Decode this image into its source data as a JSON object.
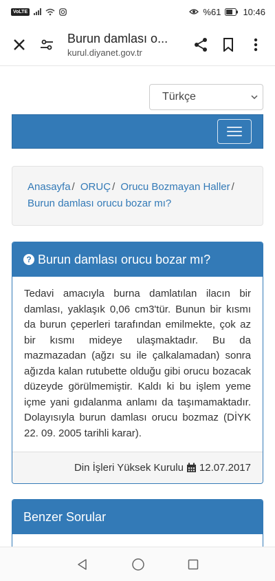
{
  "status": {
    "volte": "VoLTE",
    "battery": "%61",
    "time": "10:46"
  },
  "browser": {
    "title": "Burun damlası o...",
    "url": "kurul.diyanet.gov.tr"
  },
  "language": {
    "selected": "Türkçe"
  },
  "breadcrumb": {
    "items": [
      "Anasayfa",
      "ORUÇ",
      "Orucu Bozmayan Haller"
    ],
    "separator": "/",
    "current": "Burun damlası orucu bozar mı?"
  },
  "question": {
    "title": "Burun damlası orucu bozar mı?",
    "body": "Tedavi amacıyla burna damlatılan ilacın bir damlası, yaklaşık 0,06 cm3'tür. Bunun bir kısmı da burun çeperleri tarafından emilmekte, çok az bir kısmı mideye ulaşmaktadır. Bu da mazmazadan (ağzı su ile çalkalamadan) sonra ağızda kalan rutubette olduğu gibi orucu bozacak düzeyde görülmemiştir. Kaldı ki bu işlem yeme içme yani gıdalanma anlamı da taşımamaktadır. Dolayısıyla burun damlası orucu bozmaz (DİYK 22. 09. 2005 tarihli karar).",
    "source": "Din İşleri Yüksek Kurulu",
    "date": "12.07.2017"
  },
  "similar": {
    "title": "Benzer Sorular"
  },
  "colors": {
    "primary": "#337ab7",
    "link": "#337ab7"
  }
}
